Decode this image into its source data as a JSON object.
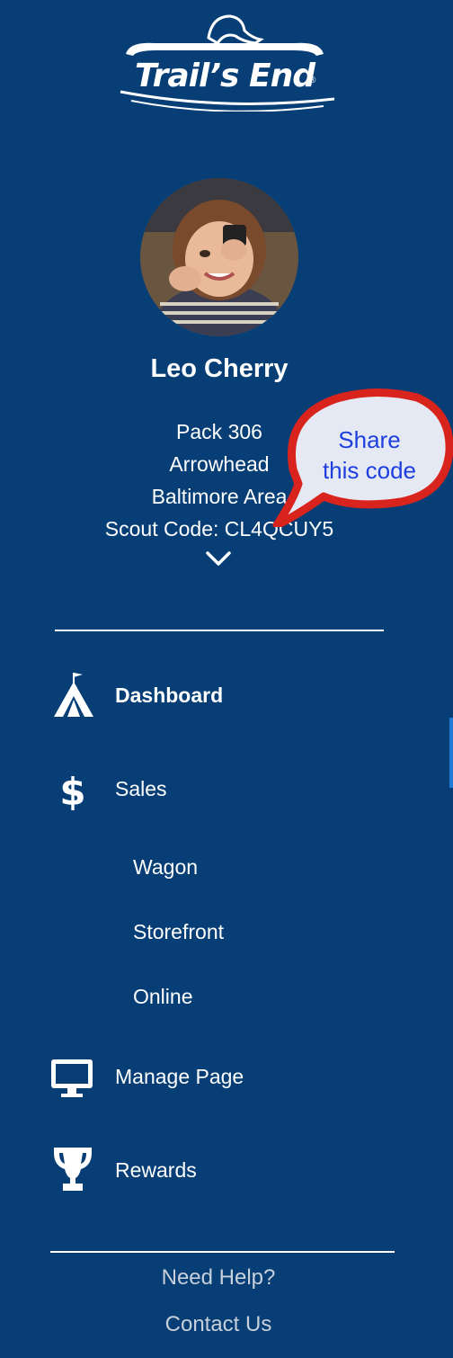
{
  "brand": {
    "logo_text": "Trail’s End",
    "registered": "®"
  },
  "profile": {
    "name": "Leo Cherry",
    "unit": "Pack 306",
    "district": "Arrowhead",
    "council": "Baltimore Area",
    "scout_code": "Scout Code: CL4QCUY5",
    "avatar_icon": "scout-photo"
  },
  "callout": {
    "line1": "Share",
    "line2": "this code"
  },
  "nav": {
    "dashboard": {
      "label": "Dashboard",
      "icon": "tent-icon"
    },
    "sales": {
      "label": "Sales",
      "icon": "dollar-icon",
      "sub": [
        "Wagon",
        "Storefront",
        "Online"
      ]
    },
    "manage_page": {
      "label": "Manage Page",
      "icon": "monitor-icon"
    },
    "rewards": {
      "label": "Rewards",
      "icon": "trophy-icon"
    }
  },
  "footer": {
    "help": "Need Help?",
    "contact": "Contact Us"
  },
  "colors": {
    "background": "#063e75",
    "text": "#ffffff",
    "callout_border": "#d9231d",
    "callout_text": "#1e3fe0",
    "footer_text": "#c7d0db"
  }
}
